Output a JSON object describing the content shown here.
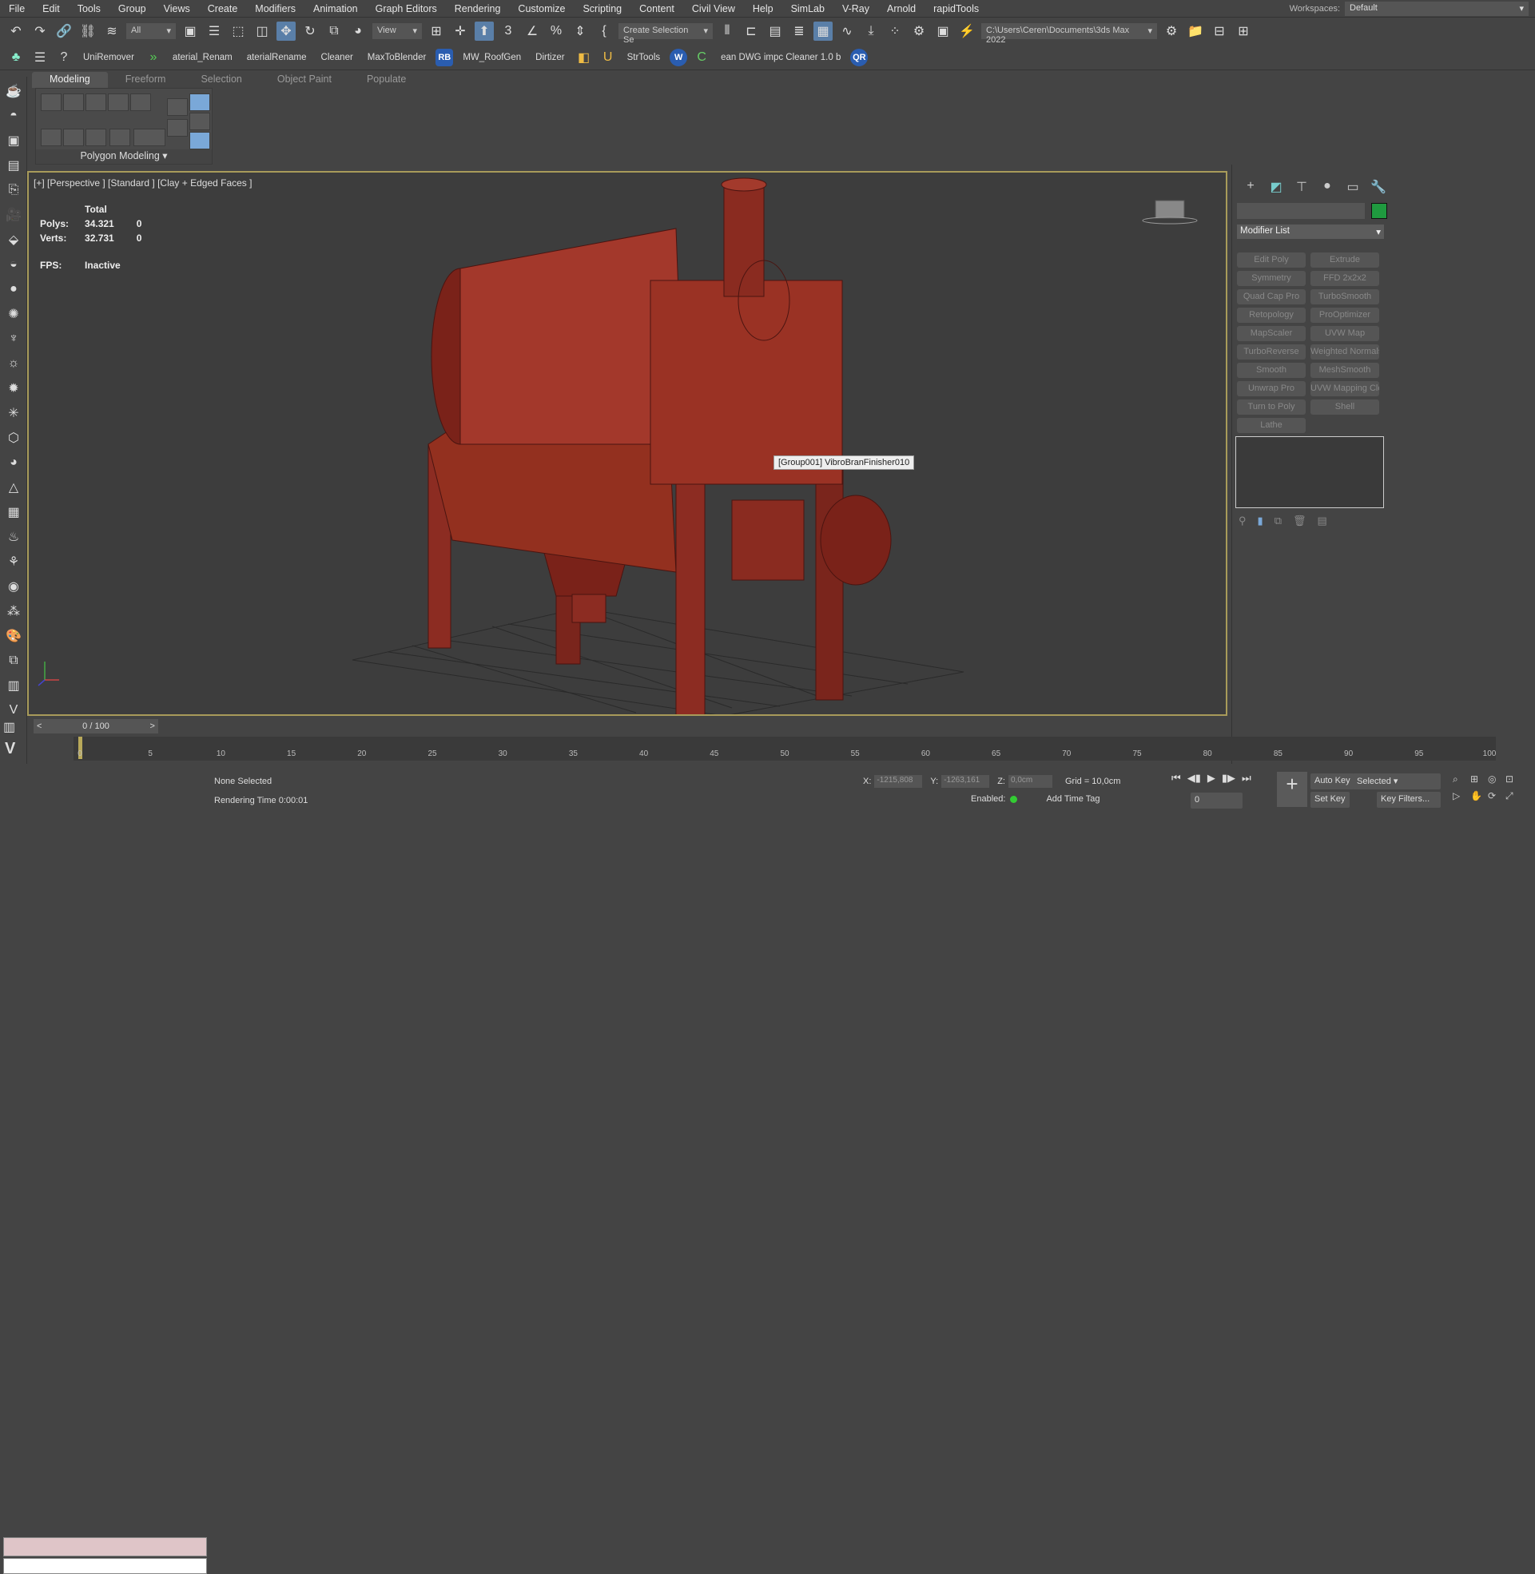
{
  "menu": [
    "File",
    "Edit",
    "Tools",
    "Group",
    "Views",
    "Create",
    "Modifiers",
    "Animation",
    "Graph Editors",
    "Rendering",
    "Customize",
    "Scripting",
    "Content",
    "Civil View",
    "Help",
    "SimLab",
    "V-Ray",
    "Arnold",
    "rapidTools"
  ],
  "workspaces": {
    "label": "Workspaces:",
    "value": "Default"
  },
  "toolbar": {
    "filter": "All",
    "ref_coord": "View",
    "selection_set": "Create Selection Se",
    "project_path": "C:\\Users\\Ceren\\Documents\\3ds Max 2022"
  },
  "scripts": [
    "UniRemover",
    "aterial_Renam",
    "aterialRename",
    "Cleaner",
    "MaxToBlender",
    "RB",
    "MW_RoofGen",
    "Dirtizer",
    "StrTools",
    "W",
    "ean DWG impc Cleaner 1.0 b",
    "QR"
  ],
  "ribbon": {
    "tabs": [
      "Modeling",
      "Freeform",
      "Selection",
      "Object Paint",
      "Populate"
    ],
    "panel": "Polygon Modeling"
  },
  "viewport": {
    "label": "[+] [Perspective ] [Standard ] [Clay + Edged Faces ]",
    "stats": {
      "header": "Total",
      "polys_label": "Polys:",
      "polys": "34.321",
      "polys_sel": "0",
      "verts_label": "Verts:",
      "verts": "32.731",
      "verts_sel": "0",
      "fps_label": "FPS:",
      "fps": "Inactive"
    },
    "tooltip": "[Group001] VibroBranFinisher010"
  },
  "command_panel": {
    "modifier_list": "Modifier List",
    "modifiers": [
      "Edit Poly",
      "Extrude",
      "Symmetry",
      "FFD 2x2x2",
      "Quad Cap Pro",
      "TurboSmooth",
      "Retopology",
      "ProOptimizer",
      "MapScaler",
      "UVW Map",
      "TurboReverse",
      "Weighted Normals",
      "Smooth",
      "MeshSmooth",
      "Unwrap Pro",
      "UVW Mapping Clea",
      "Turn to Poly",
      "Shell",
      "Lathe"
    ],
    "color": "#1f9a3f"
  },
  "timeline": {
    "slider": "0 / 100",
    "ticks": [
      "0",
      "5",
      "10",
      "15",
      "20",
      "25",
      "30",
      "35",
      "40",
      "45",
      "50",
      "55",
      "60",
      "65",
      "70",
      "75",
      "80",
      "85",
      "90",
      "95",
      "100"
    ]
  },
  "status": {
    "selection": "None Selected",
    "render_time": "Rendering Time  0:00:01",
    "x_label": "X:",
    "x": "-1215,808",
    "y_label": "Y:",
    "y": "-1263,161",
    "z_label": "Z:",
    "z": "0,0cm",
    "grid": "Grid = 10,0cm",
    "enabled": "Enabled:",
    "add_time_tag": "Add Time Tag",
    "auto_key": "Auto Key",
    "set_key": "Set Key",
    "key_mode": "Selected",
    "key_filters": "Key Filters...",
    "frame": "0"
  }
}
